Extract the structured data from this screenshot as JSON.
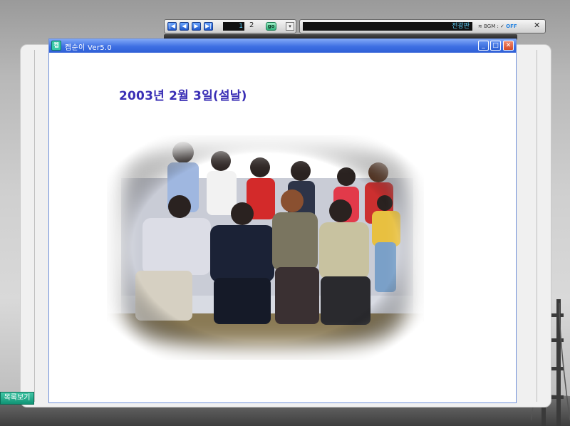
{
  "player": {
    "buttons": [
      "|◀",
      "◀",
      "▶",
      "▶|"
    ],
    "track_display": "1",
    "track_number": "2",
    "go_label": "go",
    "dropdown_icon": "▾"
  },
  "song_bar": {
    "song_text": "전광판",
    "bgm_label": "≋ BGM : ✓ ",
    "bgm_state": "OFF",
    "close_label": "✕"
  },
  "window": {
    "title": "켑순이 Ver5.0",
    "icon_glyph": "켑",
    "minimize": "_",
    "maximize": "□",
    "close": "✕"
  },
  "content": {
    "date_title": "2003년 2월 3일(설날)"
  },
  "sidebar": {
    "list_button": "목록보기"
  },
  "colors": {
    "title_blue": "#3d6fe3",
    "date_text": "#3a2fb5",
    "accent_teal": "#109475"
  }
}
